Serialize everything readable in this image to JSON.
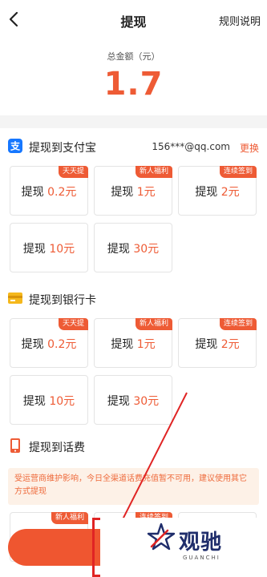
{
  "header": {
    "title": "提现",
    "rules_label": "规则说明"
  },
  "total": {
    "label": "总金额（元）",
    "amount": "1.7"
  },
  "alipay": {
    "title": "提现到支付宝",
    "account": "156***@qq.com",
    "change_label": "更换",
    "options": [
      {
        "prefix": "提现",
        "amount": "0.2元",
        "badge": "天天提"
      },
      {
        "prefix": "提现",
        "amount": "1元",
        "badge": "新人福利"
      },
      {
        "prefix": "提现",
        "amount": "2元",
        "badge": "连续签到"
      },
      {
        "prefix": "提现",
        "amount": "10元",
        "badge": ""
      },
      {
        "prefix": "提现",
        "amount": "30元",
        "badge": ""
      }
    ]
  },
  "bank": {
    "title": "提现到银行卡",
    "options": [
      {
        "prefix": "提现",
        "amount": "0.2元",
        "badge": "天天提"
      },
      {
        "prefix": "提现",
        "amount": "1元",
        "badge": "新人福利"
      },
      {
        "prefix": "提现",
        "amount": "2元",
        "badge": "连续签到"
      },
      {
        "prefix": "提现",
        "amount": "10元",
        "badge": ""
      },
      {
        "prefix": "提现",
        "amount": "30元",
        "badge": ""
      }
    ]
  },
  "phone": {
    "title": "提现到话费",
    "notice": "受运营商维护影响，今日全渠道话费充值暂不可用，建议使用其它方式提现",
    "options": [
      {
        "badge": "新人福利"
      },
      {
        "badge": "连续签到"
      }
    ]
  },
  "colors": {
    "accent": "#ee5b35",
    "alipay_blue": "#1677ff",
    "annotation_red": "#e02424"
  },
  "watermark": {
    "cn": "观驰",
    "en": "GUANCHI"
  }
}
